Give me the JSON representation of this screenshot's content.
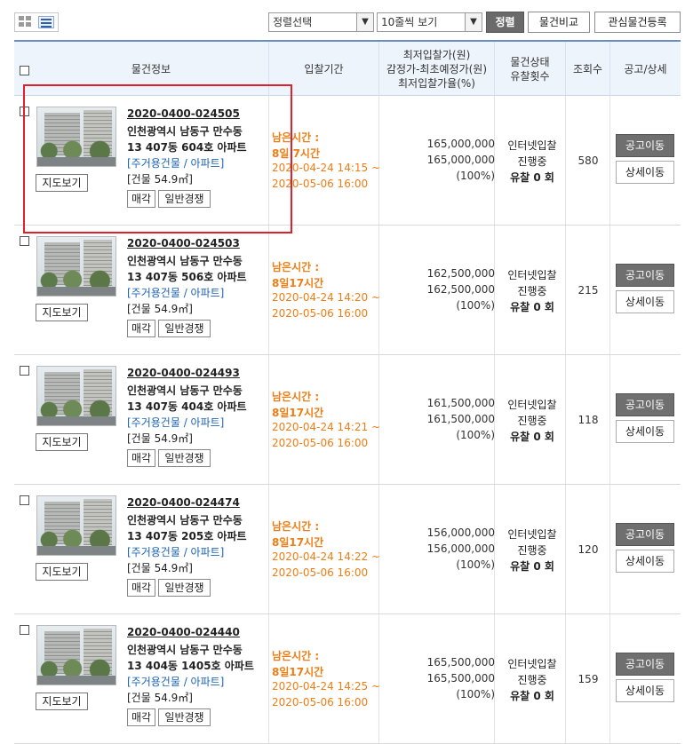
{
  "toolbar": {
    "sort_select": "정렬선택",
    "page_size_select": "10줄씩 보기",
    "sort_button": "정렬",
    "compare_button": "물건비교",
    "watch_button": "관심물건등록"
  },
  "table": {
    "headers": {
      "info": "물건정보",
      "period": "입찰기간",
      "price_line1": "최저입찰가(원)",
      "price_line2": "감정가-최초예정가(원)",
      "price_line3": "최저입찰가율(%)",
      "status_line1": "물건상태",
      "status_line2": "유찰횟수",
      "views": "조회수",
      "notice": "공고/상세"
    },
    "labels": {
      "map": "지도보기",
      "notice_btn": "공고이동",
      "detail_btn": "상세이동"
    },
    "rows": [
      {
        "case_no": "2020-0400-024505",
        "addr1": "인천광역시 남동구 만수동",
        "addr2": "13 407동 604호 아파트",
        "type": "[주거용건물 / 아파트]",
        "area": "[건물 54.9㎡]",
        "tag1": "매각",
        "tag2": "일반경쟁",
        "remain1": "남은시간 :",
        "remain2": "8일 7시간",
        "date_start": "2020-04-24 14:15 ~",
        "date_end": "2020-05-06 16:00",
        "min_price": "165,000,000",
        "appraisal": "165,000,000",
        "rate": "(100%)",
        "status1": "인터넷입찰",
        "status2": "진행중",
        "fail_count": "유찰 0 회",
        "views": "580"
      },
      {
        "case_no": "2020-0400-024503",
        "addr1": "인천광역시 남동구 만수동",
        "addr2": "13 407동 506호 아파트",
        "type": "[주거용건물 / 아파트]",
        "area": "[건물 54.9㎡]",
        "tag1": "매각",
        "tag2": "일반경쟁",
        "remain1": "남은시간 :",
        "remain2": "8일17시간",
        "date_start": "2020-04-24 14:20 ~",
        "date_end": "2020-05-06 16:00",
        "min_price": "162,500,000",
        "appraisal": "162,500,000",
        "rate": "(100%)",
        "status1": "인터넷입찰",
        "status2": "진행중",
        "fail_count": "유찰 0 회",
        "views": "215"
      },
      {
        "case_no": "2020-0400-024493",
        "addr1": "인천광역시 남동구 만수동",
        "addr2": "13 407동 404호 아파트",
        "type": "[주거용건물 / 아파트]",
        "area": "[건물 54.9㎡]",
        "tag1": "매각",
        "tag2": "일반경쟁",
        "remain1": "남은시간 :",
        "remain2": "8일17시간",
        "date_start": "2020-04-24 14:21 ~",
        "date_end": "2020-05-06 16:00",
        "min_price": "161,500,000",
        "appraisal": "161,500,000",
        "rate": "(100%)",
        "status1": "인터넷입찰",
        "status2": "진행중",
        "fail_count": "유찰 0 회",
        "views": "118"
      },
      {
        "case_no": "2020-0400-024474",
        "addr1": "인천광역시 남동구 만수동",
        "addr2": "13 407동 205호 아파트",
        "type": "[주거용건물 / 아파트]",
        "area": "[건물 54.9㎡]",
        "tag1": "매각",
        "tag2": "일반경쟁",
        "remain1": "남은시간 :",
        "remain2": "8일17시간",
        "date_start": "2020-04-24 14:22 ~",
        "date_end": "2020-05-06 16:00",
        "min_price": "156,000,000",
        "appraisal": "156,000,000",
        "rate": "(100%)",
        "status1": "인터넷입찰",
        "status2": "진행중",
        "fail_count": "유찰 0 회",
        "views": "120"
      },
      {
        "case_no": "2020-0400-024440",
        "addr1": "인천광역시 남동구 만수동",
        "addr2": "13 404동 1405호 아파트",
        "type": "[주거용건물 / 아파트]",
        "area": "[건물 54.9㎡]",
        "tag1": "매각",
        "tag2": "일반경쟁",
        "remain1": "남은시간 :",
        "remain2": "8일17시간",
        "date_start": "2020-04-24 14:25 ~",
        "date_end": "2020-05-06 16:00",
        "min_price": "165,500,000",
        "appraisal": "165,500,000",
        "rate": "(100%)",
        "status1": "인터넷입찰",
        "status2": "진행중",
        "fail_count": "유찰 0 회",
        "views": "159"
      }
    ]
  }
}
